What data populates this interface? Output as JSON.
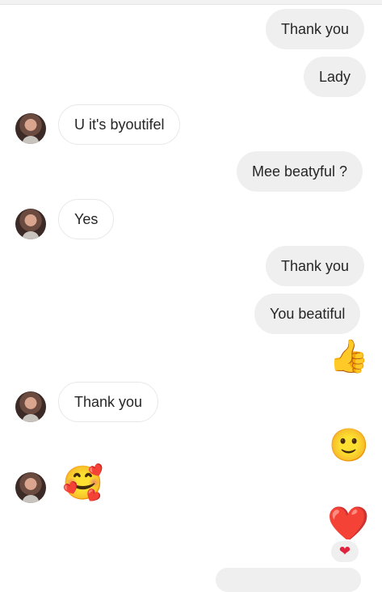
{
  "messages": [
    {
      "type": "outgoing",
      "text": "Thank you"
    },
    {
      "type": "outgoing",
      "text": "Lady"
    },
    {
      "type": "incoming",
      "text": "U it's byoutifel"
    },
    {
      "type": "outgoing",
      "text": "Mee beatyful ?"
    },
    {
      "type": "incoming",
      "text": "Yes"
    },
    {
      "type": "outgoing",
      "text": "Thank you"
    },
    {
      "type": "outgoing",
      "text": "You beatiful"
    },
    {
      "type": "outgoing-emoji",
      "emoji": "👍"
    },
    {
      "type": "incoming",
      "text": "Thank you"
    },
    {
      "type": "outgoing-emoji",
      "emoji": "🙂"
    },
    {
      "type": "incoming-emoji",
      "emoji": "🥰"
    },
    {
      "type": "outgoing-emoji",
      "emoji": "❤️",
      "reaction": "❤"
    }
  ],
  "colors": {
    "outgoing_bubble": "#efefef",
    "incoming_bubble": "#ffffff",
    "text": "#262626",
    "heart": "#e0233c"
  },
  "icons": {
    "avatar": "contact-avatar",
    "reaction": "heart-icon"
  }
}
